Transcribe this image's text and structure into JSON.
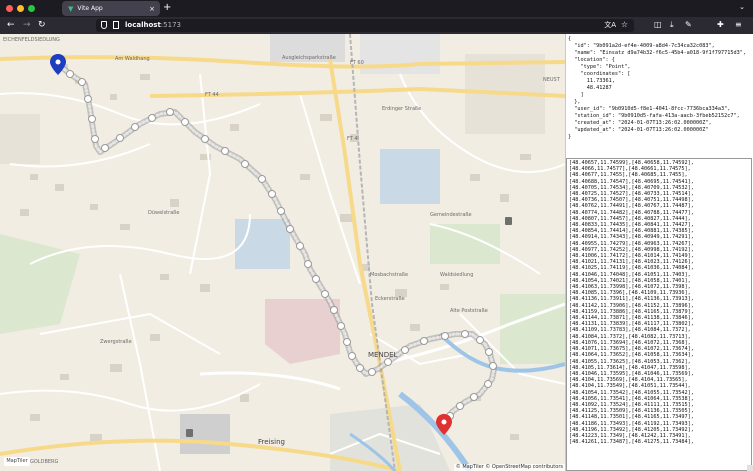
{
  "browser": {
    "tab_title": "Vite App",
    "tab_icon": "vue-logo-icon",
    "url_host": "localhost",
    "url_port": ":5173",
    "accent": "#41b883"
  },
  "map": {
    "labels": {
      "eichenfeldsiedlung": "EICHENFELDSIEDLUNG",
      "neust": "NEUST",
      "mendel": "MENDEL",
      "freising": "Freising",
      "goldberg": "GOLDBERG",
      "am_wald": "Am Waldhang",
      "ausgleich": "Ausgleichsparkstraße",
      "ft60": "FT 60",
      "ft44": "FT 44",
      "ft4": "FT 4",
      "erhalt": "Erdinger Straße",
      "dowel": "Düwelstraße",
      "gemeinde": "Gemeindestraße",
      "waldsiedlung": "Waldsiedlung",
      "mosbach": "Mosbachstraße",
      "eckerstr": "Eckerstraße",
      "muehle": "Alte Poststraße",
      "zwergstr": "Zwergstraße"
    },
    "attribution": "© MapTiler © OpenStreetMap contributors",
    "start_marker_color": "#1d3fbf",
    "end_marker_color": "#e03131",
    "route_color": "#9a9a9a"
  },
  "record": {
    "lines": [
      "{",
      "  \"id\": \"9b091a2d-ef4e-4009-a8d4-7c34ca32c083\",",
      "  \"name\": \"Einsatz d9a74b32-f6c5-45b4-a018-9f1f797715d3\",",
      "  \"location\": {",
      "    \"type\": \"Point\",",
      "    \"coordinates\": [",
      "      11.73361,",
      "      48.41287",
      "    ]",
      "  },",
      "  \"user_id\": \"9b0910d5-f8e1-4041-8fcc-7736bca334a3\",",
      "  \"station_id\": \"9b0910d5-fafa-413a-aacb-3fbeb52152c7\",",
      "  \"created_at\": \"2024-01-07T13:26:02.000000Z\",",
      "  \"updated_at\": \"2024-01-07T13:26:02.000000Z\"",
      "}"
    ]
  },
  "coordinates_text": [
    "[48.40657,11.74599],[48.40658,11.74592],",
    "[48.4066,11.74577],[48.40661,11.74575],",
    "[48.40677,11.7455],[48.40685,11.7455],",
    "[48.40688,11.74547],[48.40695,11.74541],",
    "[48.40705,11.74534],[48.40709,11.74532],",
    "[48.40725,11.74527],[48.40733,11.74514],",
    "[48.40736,11.74507],[48.40751,11.74498],",
    "[48.40762,11.74491],[48.40767,11.74487],",
    "[48.40774,11.74482],[48.40788,11.74477],",
    "[48.40807,11.74457],[48.40827,11.7444],",
    "[48.40833,11.74435],[48.40841,11.74427],",
    "[48.40854,11.74414],[48.40881,11.74385],",
    "[48.40914,11.74343],[48.40949,11.74291],",
    "[48.40955,11.74279],[48.40963,11.74267],",
    "[48.40977,11.74252],[48.40998,11.74192],",
    "[48.41006,11.74172],[48.41014,11.74149],",
    "[48.41021,11.74131],[48.41023,11.74126],",
    "[48.41025,11.74119],[48.41036,11.74084],",
    "[48.41046,11.74048],[48.41051,11.7403],",
    "[48.41054,11.74021],[48.41058,11.7401],",
    "[48.41063,11.73998],[48.41072,11.7398],",
    "[48.41085,11.7396],[48.41109,11.73936],",
    "[48.41136,11.73911],[48.41136,11.73913],",
    "[48.41142,11.73906],[48.41152,11.73896],",
    "[48.41159,11.73886],[48.41165,11.73879],",
    "[48.41144,11.73871],[48.41138,11.73846],",
    "[48.41131,11.73839],[48.41117,11.73802],",
    "[48.41109,11.73783],[48.41084,11.7372],",
    "[48.41084,11.7372],[48.41082,11.73713],",
    "[48.41076,11.73694],[48.41072,11.7368],",
    "[48.41071,11.73675],[48.41072,11.73674],",
    "[48.41064,11.73652],[48.41058,11.73634],",
    "[48.41055,11.73625],[48.41053,11.7362],",
    "[48.4105,11.73614],[48.41047,11.73598],",
    "[48.41046,11.73595],[48.41046,11.73569],",
    "[48.4104,11.73569],[48.4104,11.73565],",
    "[48.4104,11.73549],[48.41051,11.73544],",
    "[48.41054,11.73542],[48.41055,11.73542],",
    "[48.41056,11.73541],[48.41064,11.73538],",
    "[48.41092,11.73524],[48.41111,11.73515],",
    "[48.41125,11.73509],[48.41136,11.73505],",
    "[48.41148,11.73501],[48.41165,11.73497],",
    "[48.41186,11.73493],[48.41192,11.73493],",
    "[48.41196,11.73492],[48.41205,11.73492],",
    "[48.41223,11.7349],[48.41242,11.73491],",
    "[48.41261,11.73487],[48.41275,11.73484],"
  ]
}
